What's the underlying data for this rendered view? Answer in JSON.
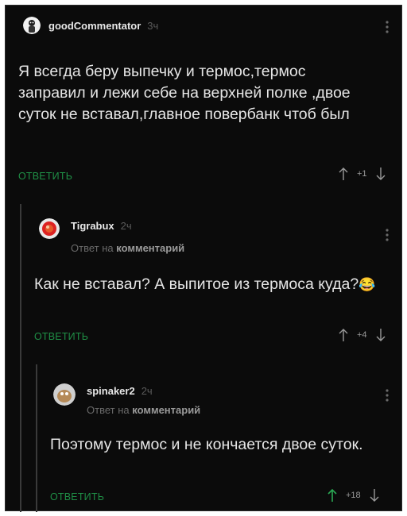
{
  "comments": [
    {
      "username": "goodCommentator",
      "time": "3ч",
      "text": "Я всегда беру выпечку и термос,термос заправил и лежи себе на верхней полке ,двое суток не вставал,главное повербанк чтоб был",
      "reply_label": "ОТВЕТИТЬ",
      "score": "+1"
    },
    {
      "username": "Tigrabux",
      "time": "2ч",
      "reply_prefix": "Ответ на",
      "reply_target": "комментарий",
      "text": "Как не вставал? А выпитое из термоса куда?",
      "emoji": "😂",
      "reply_label": "ОТВЕТИТЬ",
      "score": "+4"
    },
    {
      "username": "spinaker2",
      "time": "2ч",
      "reply_prefix": "Ответ на",
      "reply_target": "комментарий",
      "text": "Поэтому термос и не кончается двое суток.",
      "reply_label": "ОТВЕТИТЬ",
      "score": "+18"
    }
  ],
  "colors": {
    "background": "#0b0b0b",
    "accent": "#1f8f46",
    "text": "#e6e6e6",
    "muted": "#6a6a6a",
    "upvoted": "#2aa854"
  },
  "icons": [
    "avatar",
    "kebab-menu-icon",
    "upvote-arrow-icon",
    "downvote-arrow-icon"
  ]
}
